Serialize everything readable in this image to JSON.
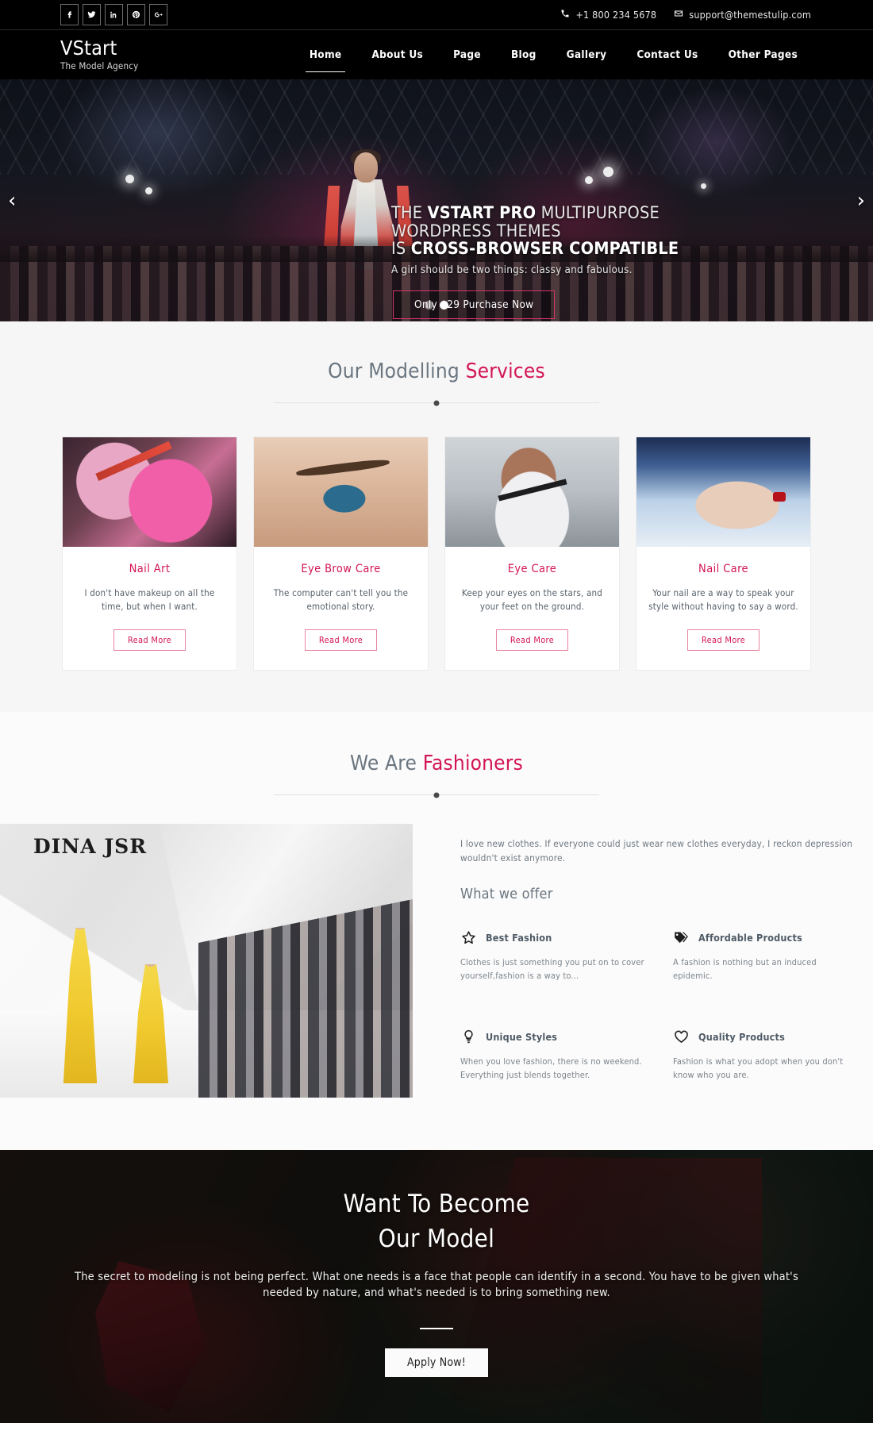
{
  "topbar": {
    "socials": [
      {
        "name": "facebook-icon",
        "label": "f"
      },
      {
        "name": "twitter-icon",
        "label": "t"
      },
      {
        "name": "linkedin-icon",
        "label": "in"
      },
      {
        "name": "pinterest-icon",
        "label": "p"
      },
      {
        "name": "googleplus-icon",
        "label": "g+"
      }
    ],
    "phone": "+1 800 234 5678",
    "email": "support@themestulip.com"
  },
  "brand": {
    "name": "VStart",
    "tagline": "The Model Agency"
  },
  "nav": {
    "items": [
      {
        "label": "Home",
        "active": true
      },
      {
        "label": "About Us",
        "active": false
      },
      {
        "label": "Page",
        "active": false
      },
      {
        "label": "Blog",
        "active": false
      },
      {
        "label": "Gallery",
        "active": false
      },
      {
        "label": "Contact Us",
        "active": false
      },
      {
        "label": "Other Pages",
        "active": false
      }
    ]
  },
  "hero": {
    "line1_a": "THE ",
    "line1_b": "VSTART PRO",
    "line1_c": " MULTIPURPOSE",
    "line2": "WORDPRESS THEMES",
    "line3_a": "IS ",
    "line3_b": "CROSS-BROWSER COMPATIBLE",
    "subtitle": "A girl should be two things: classy and fabulous.",
    "button": "Only $29 Purchase Now",
    "prev_arrow": "‹",
    "next_arrow": "›",
    "dots": [
      {
        "active": false
      },
      {
        "active": true
      }
    ]
  },
  "services": {
    "title_plain": "Our Modelling ",
    "title_accent": "Services",
    "cards": [
      {
        "title": "Nail Art",
        "text": "I don't have makeup on all the time, but when I want.",
        "button": "Read More",
        "image": "nail-art"
      },
      {
        "title": "Eye Brow Care",
        "text": "The computer can't tell you the emotional story.",
        "button": "Read More",
        "image": "eye-brow"
      },
      {
        "title": "Eye Care",
        "text": "Keep your eyes on the stars, and your feet on the ground.",
        "button": "Read More",
        "image": "eye-care"
      },
      {
        "title": "Nail Care",
        "text": "Your nail are a way to speak your style without having to say a word.",
        "button": "Read More",
        "image": "nail-care"
      }
    ]
  },
  "fashioners": {
    "title_plain": "We Are ",
    "title_accent": "Fashioners",
    "image_caption": "DINA JSR",
    "lede": "I love new clothes. If everyone could just wear new clothes everyday, I reckon depression wouldn't exist anymore.",
    "offer_heading": "What we offer",
    "offers": [
      {
        "icon": "star-icon",
        "title": "Best Fashion",
        "text": "Clothes is just something you put on to cover yourself,fashion is a way to..."
      },
      {
        "icon": "tag-icon",
        "title": "Affordable Products",
        "text": "A fashion is nothing but an induced epidemic."
      },
      {
        "icon": "lightbulb-icon",
        "title": "Unique Styles",
        "text": "When you love fashion, there is no weekend. Everything just blends together."
      },
      {
        "icon": "heart-icon",
        "title": "Quality Products",
        "text": "Fashion is what you adopt when you don't know who you are."
      }
    ]
  },
  "cta": {
    "heading_line1": "Want To Become",
    "heading_line2": "Our Model",
    "paragraph": "The secret to modeling is not being perfect. What one needs is a face that people can identify in a second. You have to be given what's needed by nature, and what's needed is to bring something new.",
    "button": "Apply Now!"
  },
  "colors": {
    "accent_pink": "#d31557",
    "header_black": "#000000",
    "services_bg": "#f6f6f6",
    "heading_gray": "#6b7680"
  }
}
